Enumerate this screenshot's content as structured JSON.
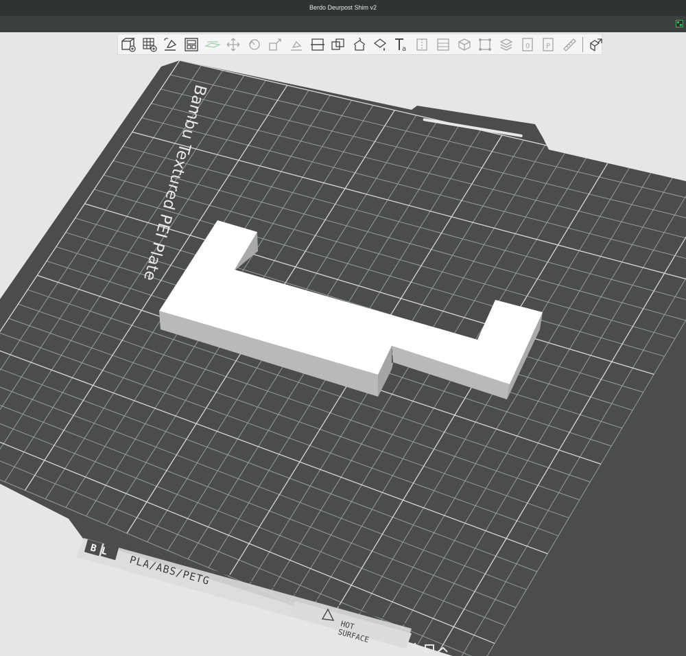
{
  "window": {
    "title": "Berdo Deurpost Shim v2"
  },
  "toolbar": {
    "buttons": [
      {
        "name": "add-object-icon",
        "label": "Add",
        "state": "normal"
      },
      {
        "name": "add-plate-icon",
        "label": "Add plate",
        "state": "normal"
      },
      {
        "name": "auto-orient-icon",
        "label": "Auto orient",
        "state": "normal"
      },
      {
        "name": "arrange-icon",
        "label": "Arrange all objects",
        "state": "normal"
      },
      {
        "name": "split-objects-icon",
        "label": "Split to objects",
        "state": "dim"
      },
      {
        "name": "move-icon",
        "label": "Move",
        "state": "dim"
      },
      {
        "name": "rotate-icon",
        "label": "Rotate",
        "state": "dim"
      },
      {
        "name": "scale-icon",
        "label": "Scale",
        "state": "dim"
      },
      {
        "name": "lay-on-face-icon",
        "label": "Lay on face",
        "state": "dim"
      },
      {
        "name": "cut-icon",
        "label": "Cut",
        "state": "normal"
      },
      {
        "name": "boolean-icon",
        "label": "Mesh boolean",
        "state": "normal"
      },
      {
        "name": "support-paint-icon",
        "label": "Support painting",
        "state": "normal"
      },
      {
        "name": "color-paint-icon",
        "label": "Color painting",
        "state": "normal"
      },
      {
        "name": "text-shape-icon",
        "label": "Text shape",
        "state": "normal"
      },
      {
        "name": "seam-paint-icon",
        "label": "Seam painting",
        "state": "dim"
      },
      {
        "name": "variable-layer-icon",
        "label": "Variable layer height",
        "state": "dim"
      },
      {
        "name": "measure-icon",
        "label": "Measure",
        "state": "dim"
      },
      {
        "name": "assembly-icon",
        "label": "Assembly",
        "state": "dim"
      },
      {
        "name": "layers-icon",
        "label": "Layers",
        "state": "dim"
      },
      {
        "name": "plate-zero-icon",
        "label": "Plate",
        "state": "dim"
      },
      {
        "name": "plate-p-icon",
        "label": "Part",
        "state": "dim"
      },
      {
        "name": "ruler-icon",
        "label": "Ruler",
        "state": "dim"
      },
      {
        "name": "explode-icon",
        "label": "Explosion view",
        "state": "normal"
      }
    ]
  },
  "plate": {
    "brand_text": "Bambu Textured PEI Plate",
    "logo_text": "BL",
    "material_text": "PLA/ABS/PETG",
    "warning_line1": "HOT",
    "warning_line2": "SURFACE",
    "plate_color": "#4b4d4d",
    "grid_color": "#a7aaaa",
    "model_color": "#ffffff"
  },
  "colors": {
    "background": "#e6e6e6",
    "titlebar": "#303333",
    "menubar": "#3b3f3f",
    "accent": "#00ae42"
  }
}
